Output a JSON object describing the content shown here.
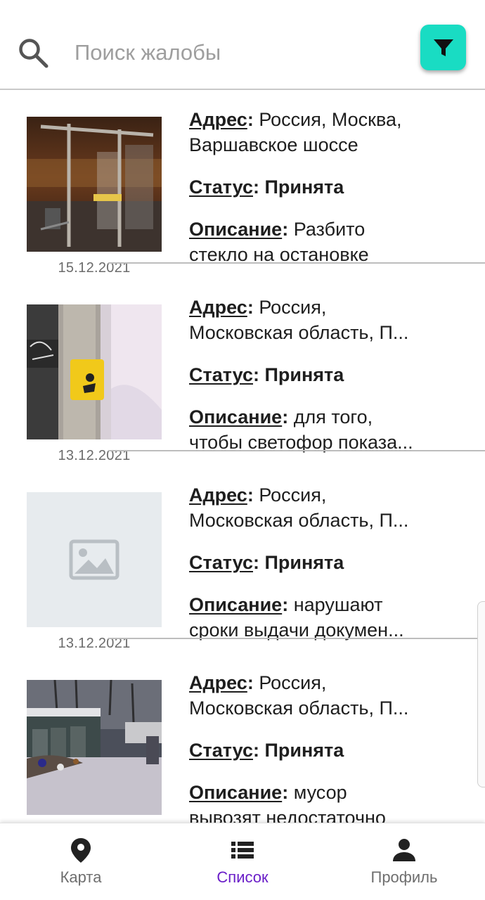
{
  "search": {
    "placeholder": "Поиск жалобы",
    "icon": "search-icon"
  },
  "filter": {
    "icon": "filter-icon",
    "color": "#19dcc3"
  },
  "labels": {
    "address": "Адрес",
    "status": "Статус",
    "description": "Описание",
    "colon": ":"
  },
  "complaints": [
    {
      "address": " Россия, Москва,",
      "address_line2": "Варшавское шоссе",
      "status": " Принята",
      "description": " Разбито",
      "description_line2": "стекло на остановке",
      "date": "15.12.2021",
      "photo": "bus-stop-broken-glass"
    },
    {
      "address": " Россия,",
      "address_line2": "Московская область, П...",
      "status": " Принята",
      "description": " для того,",
      "description_line2": "чтобы светофор показа...",
      "date": "13.12.2021",
      "photo": "traffic-light-button-pole"
    },
    {
      "address": " Россия,",
      "address_line2": "Московская область, П...",
      "status": " Принята",
      "description": " нарушают",
      "description_line2": "сроки выдачи докумен...",
      "date": "13.12.2021",
      "photo": "image-placeholder-icon"
    },
    {
      "address": " Россия,",
      "address_line2": "Московская область, П...",
      "status": " Принята",
      "description": " мусор",
      "description_line2": "вывозят недостаточно",
      "date": "",
      "photo": "overflowing-garbage-containers"
    }
  ],
  "bottom_nav": {
    "items": [
      {
        "label": "Карта",
        "icon": "map-pin-icon",
        "active": false
      },
      {
        "label": "Список",
        "icon": "list-icon",
        "active": true
      },
      {
        "label": "Профиль",
        "icon": "person-icon",
        "active": false
      }
    ],
    "active_color": "#6a1ec8"
  }
}
